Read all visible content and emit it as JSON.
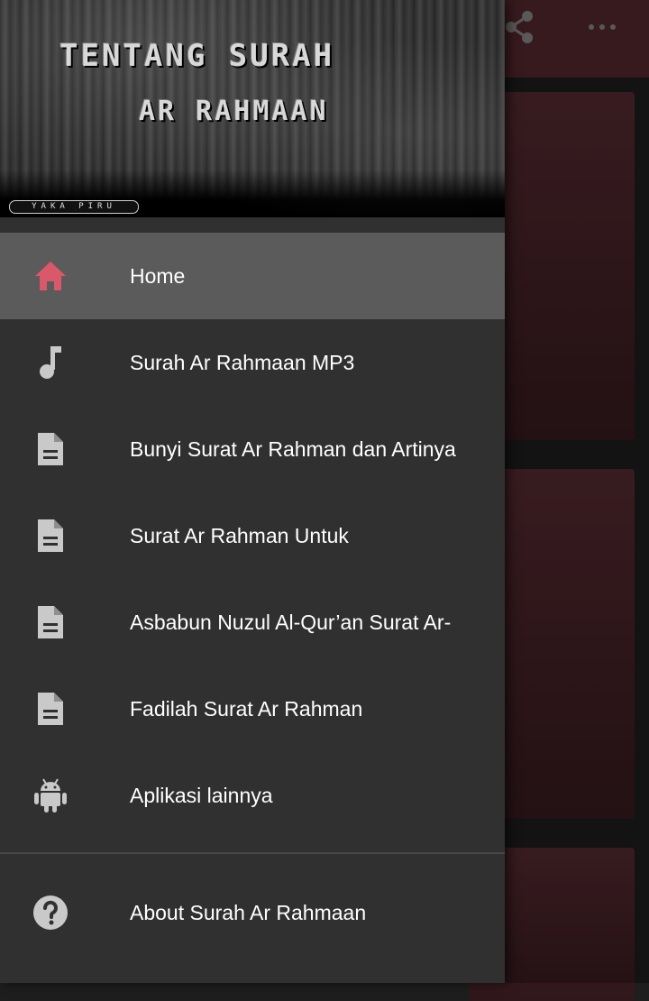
{
  "header": {
    "title_line1": "TENTANG SURAH",
    "title_line2": "AR RAHMAAN",
    "tag": "YAKA PIRU"
  },
  "menu": {
    "items": [
      {
        "label": "Home",
        "icon": "home-icon",
        "active": true
      },
      {
        "label": "Surah Ar Rahmaan MP3",
        "icon": "music-note-icon"
      },
      {
        "label": "Bunyi Surat Ar Rahman dan Artinya",
        "icon": "document-icon"
      },
      {
        "label": "Surat Ar Rahman Untuk",
        "icon": "document-icon"
      },
      {
        "label": "Asbabun Nuzul Al-Qur’an Surat Ar-",
        "icon": "document-icon"
      },
      {
        "label": "Fadilah Surat Ar Rahman",
        "icon": "document-icon"
      },
      {
        "label": "Aplikasi lainnya",
        "icon": "android-icon"
      }
    ],
    "footer_item": {
      "label": "About Surah Ar Rahmaan",
      "icon": "help-icon"
    }
  },
  "colors": {
    "appbar": "#4a2329",
    "drawer": "#303030",
    "active_item": "#5b5b5b",
    "home_icon": "#d9586a",
    "icon": "#c9c9c9"
  }
}
